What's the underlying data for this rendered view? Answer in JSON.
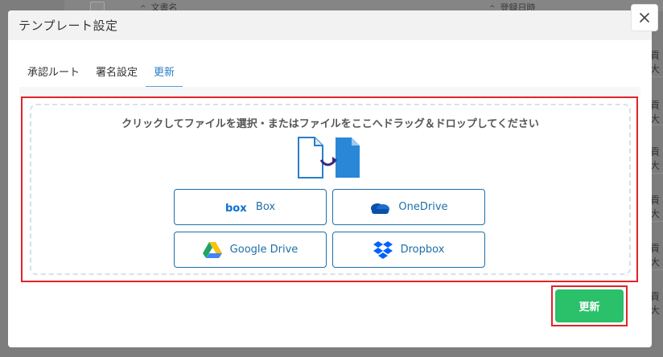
{
  "background": {
    "columns": [
      {
        "label": "文書名"
      },
      {
        "label": "登録日時"
      }
    ],
    "row_cells": [
      "貢大",
      "貢大",
      "貢大",
      "貢大",
      "貢大",
      "貢大"
    ]
  },
  "modal": {
    "title": "テンプレート設定",
    "tabs": [
      {
        "label": "承認ルート"
      },
      {
        "label": "署名設定"
      },
      {
        "label": "更新"
      }
    ],
    "active_tab": "更新",
    "dropzone": {
      "text": "クリックしてファイルを選択・またはファイルをここへドラッグ＆ドロップしてください"
    },
    "cloud_buttons": [
      {
        "label": "Box",
        "icon": "box-logo-icon"
      },
      {
        "label": "OneDrive",
        "icon": "onedrive-icon"
      },
      {
        "label": "Google Drive",
        "icon": "google-drive-icon"
      },
      {
        "label": "Dropbox",
        "icon": "dropbox-icon"
      }
    ],
    "submit_label": "更新",
    "close_icon": "close-icon"
  },
  "colors": {
    "accent": "#2a7ec7",
    "submit": "#2bc06a",
    "highlight": "#e0242a",
    "cloud_border": "#1e6fa8"
  }
}
